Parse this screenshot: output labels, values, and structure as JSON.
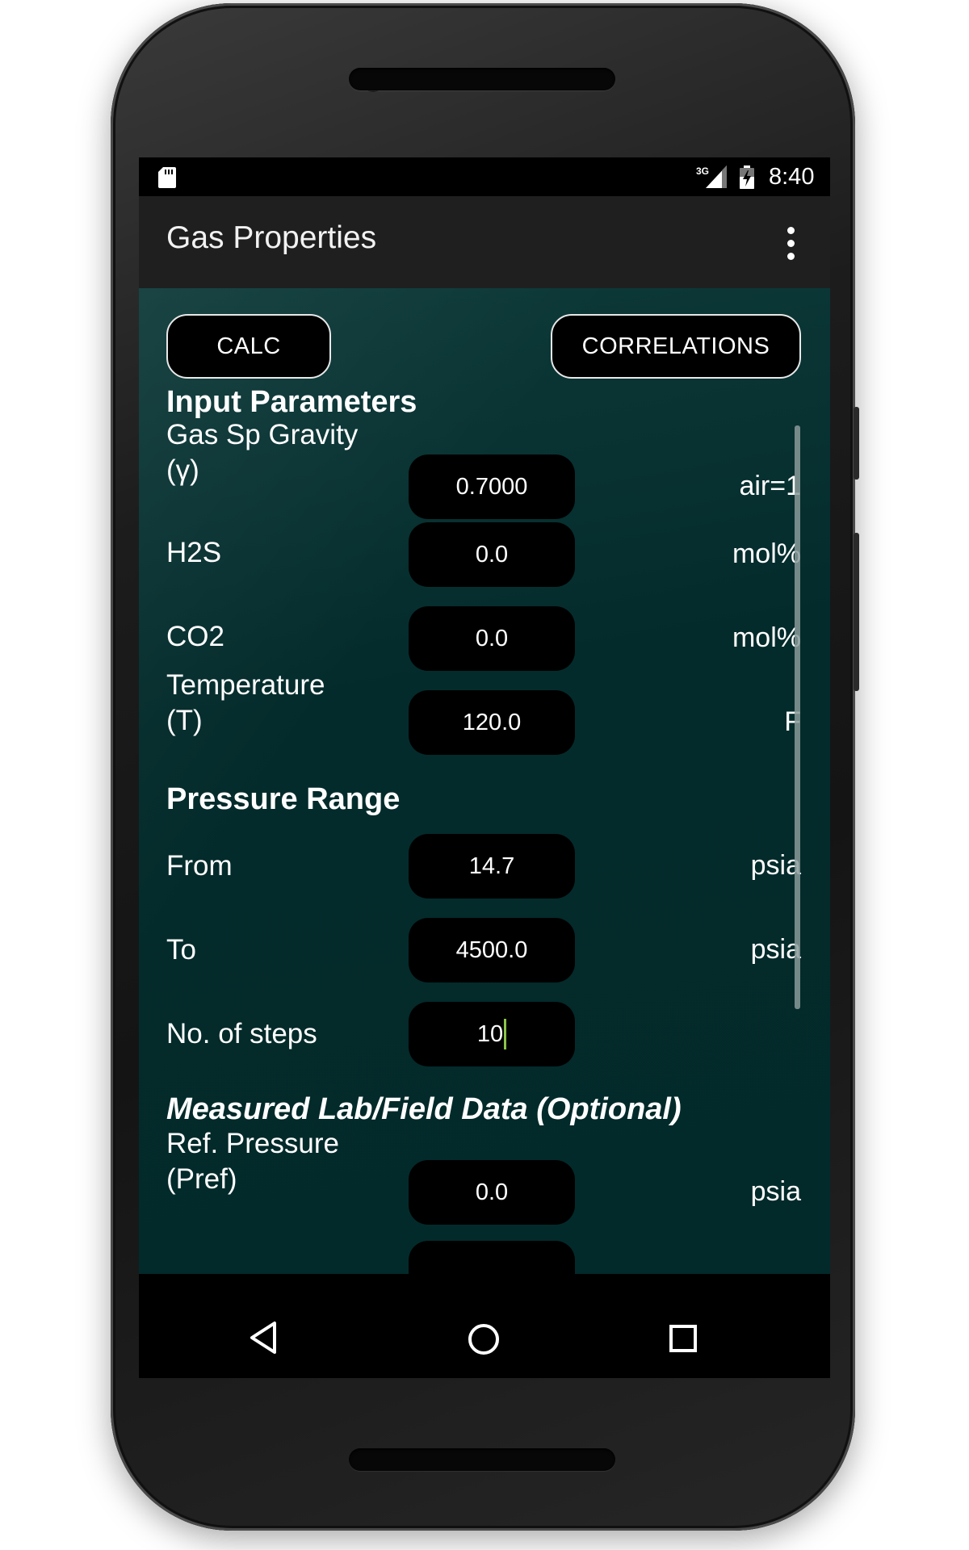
{
  "status_bar": {
    "network_label": "3G",
    "time": "8:40",
    "icons": [
      "sd-card-icon",
      "signal-3g-icon",
      "battery-charging-icon"
    ]
  },
  "toolbar": {
    "title": "Gas Properties",
    "menu_icon": "overflow-menu-icon"
  },
  "actions": {
    "calc_label": "CALC",
    "correlations_label": "CORRELATIONS"
  },
  "input_parameters": {
    "title": "Input Parameters",
    "rows": [
      {
        "label_line1": "Gas Sp Gravity",
        "label_line2": "(γ)",
        "value": "0.7000",
        "unit": "air=1"
      },
      {
        "label_line1": "H2S",
        "label_line2": "",
        "value": "0.0",
        "unit": "mol%"
      },
      {
        "label_line1": "CO2",
        "label_line2": "",
        "value": "0.0",
        "unit": "mol%"
      },
      {
        "label_line1": "Temperature",
        "label_line2": "(T)",
        "value": "120.0",
        "unit": "F"
      }
    ]
  },
  "pressure_range": {
    "title": "Pressure Range",
    "rows": [
      {
        "label": "From",
        "value": "14.7",
        "unit": "psia"
      },
      {
        "label": "To",
        "value": "4500.0",
        "unit": "psia"
      },
      {
        "label": "No. of steps",
        "value": "10",
        "unit": ""
      }
    ]
  },
  "measured_data": {
    "title": "Measured Lab/Field Data (Optional)",
    "rows": [
      {
        "label_line1": "Ref. Pressure",
        "label_line2": "(Pref)",
        "value": "0.0",
        "unit": "psia"
      }
    ]
  },
  "nav_bar": {
    "icons": [
      "back-icon",
      "home-icon",
      "recents-icon"
    ]
  },
  "colors": {
    "content_bg": "#042b2b",
    "toolbar_bg": "#1f1f1f",
    "field_bg": "#000000",
    "cursor": "#8bc34a"
  }
}
